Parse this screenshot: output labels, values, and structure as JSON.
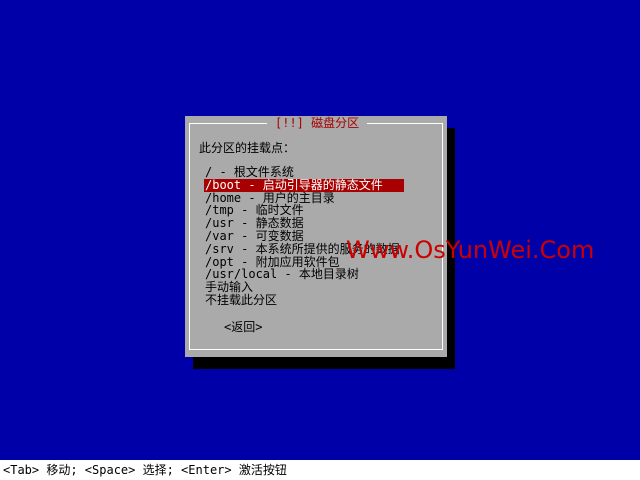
{
  "dialog": {
    "title": "[!!] 磁盘分区",
    "prompt": "此分区的挂载点：",
    "options": [
      "/ - 根文件系统",
      "/boot - 启动引导器的静态文件",
      "/home - 用户的主目录",
      "/tmp - 临时文件",
      "/usr - 静态数据",
      "/var - 可变数据",
      "/srv - 本系统所提供的服务的数据",
      "/opt - 附加应用软件包",
      "/usr/local - 本地目录树",
      "手动输入",
      "不挂载此分区"
    ],
    "selected_index": 1,
    "back_label": "<返回>"
  },
  "watermark": "Www.OsYunWei.Com",
  "status_bar": "<Tab> 移动; <Space> 选择; <Enter> 激活按钮",
  "colors": {
    "background": "#0000a8",
    "dialog": "#aaaaaa",
    "title": "#a80000",
    "selection": "#a80000",
    "watermark": "#cc0000"
  }
}
